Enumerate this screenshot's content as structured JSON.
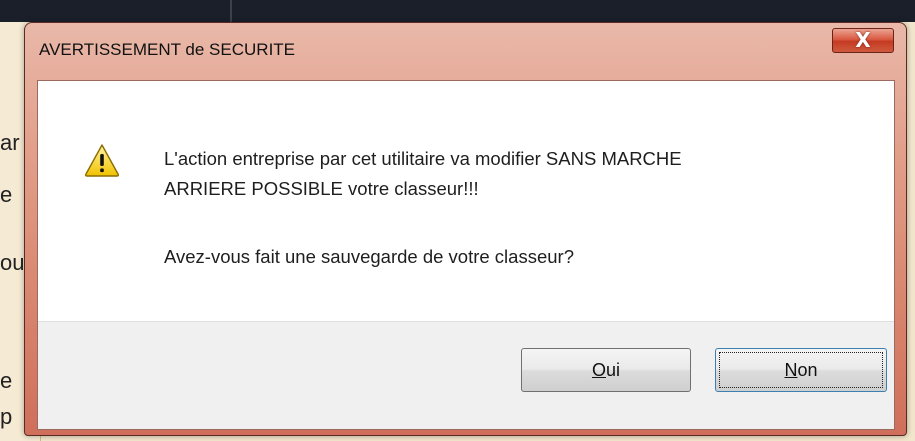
{
  "dialog": {
    "title": "AVERTISSEMENT de SECURITE",
    "close_label": "X",
    "icon": "warning-icon",
    "message_line1": "L'action entreprise par cet utilitaire va modifier SANS MARCHE",
    "message_line2": "ARRIERE POSSIBLE votre classeur!!!",
    "question": "Avez-vous fait une sauvegarde de votre classeur?",
    "buttons": {
      "yes": {
        "mnemonic": "O",
        "rest": "ui"
      },
      "no": {
        "mnemonic": "N",
        "rest": "on"
      }
    }
  },
  "background_window": {
    "fragments": [
      "ar",
      "e",
      "ou",
      "e",
      "p"
    ]
  },
  "colors": {
    "frame": "#d98770",
    "close_button": "#c43a22",
    "focus_border": "#3c7fb1"
  }
}
